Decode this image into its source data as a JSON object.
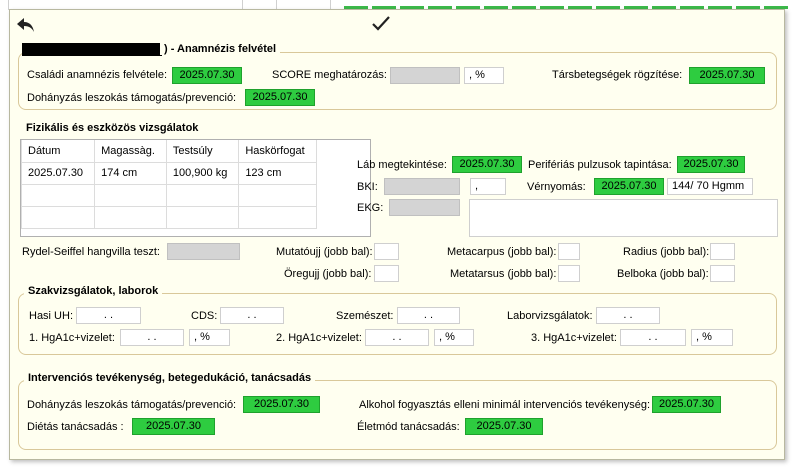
{
  "toolbar": {
    "back_icon": "back-arrow-icon",
    "confirm_icon": "checkmark-icon"
  },
  "anamnesis": {
    "title": ") - Anamnézis felvétel",
    "family_label": "Családi anamnézis felvétele:",
    "family_date": "2025.07.30",
    "score_label": "SCORE meghatározás:",
    "score_unit": ", %",
    "comorb_label": "Társbetegségek rögzítése:",
    "comorb_date": "2025.07.30",
    "smoking_label": "Dohányzás leszokás támogatás/prevenció:",
    "smoking_date": "2025.07.30"
  },
  "exam": {
    "title": "Fizikális és eszközös vizsgálatok",
    "columns": [
      "Dátum",
      "Magassàg.",
      "Testsúly",
      "Haskörfogat"
    ],
    "rows": [
      [
        "2025.07.30",
        "174 cm",
        "100,900 kg",
        "123 cm"
      ]
    ],
    "foot_label": "Láb megtekintése:",
    "foot_date": "2025.07.30",
    "pulse_label": "Perifériás pulzusok tapintása:",
    "pulse_date": "2025.07.30",
    "bmi_label": "BKI:",
    "bmi_value": ",",
    "bp_label": "Vérnyomás:",
    "bp_date": "2025.07.30",
    "bp_value": "144/ 70 Hgmm",
    "ekg_label": "EKG:",
    "rydel_label": "Rydel-Seiffel hangvilla teszt:",
    "pointer_label": "Mutatóujj (jobb bal):",
    "metacarpus_label": "Metacarpus (jobb bal):",
    "radius_label": "Radius (jobb bal):",
    "bigtoe_label": "Öregujj (jobb bal):",
    "metatarsus_label": "Metatarsus (jobb bal):",
    "ankle_label": "Belboka (jobb bal):"
  },
  "specialist": {
    "title": "Szakvizsgálatok, laborok",
    "hasi_label": "Hasi UH:",
    "hasi_value": ". .",
    "cds_label": "CDS:",
    "cds_value": ". .",
    "eye_label": "Szemészet:",
    "eye_value": ". .",
    "lab_label": "Laborvizsgálatok:",
    "lab_value": ". .",
    "hba1c1_label": "1. HgA1c+vizelet:",
    "hba1c1_date": ". .",
    "hba1c1_pct": ", %",
    "hba1c2_label": "2. HgA1c+vizelet:",
    "hba1c2_date": ". .",
    "hba1c2_pct": ", %",
    "hba1c3_label": "3. HgA1c+vizelet:",
    "hba1c3_date": ". .",
    "hba1c3_pct": ", %"
  },
  "intervention": {
    "title": "Intervenciós tevékenység, betegedukáció, tanácsadás",
    "smoking_label": "Dohányzás leszokás támogatás/prevenció:",
    "smoking_date": "2025.07.30",
    "alcohol_label": "Alkohol fogyasztás elleni minimál intervenciós tevékenység:",
    "alcohol_date": "2025.07.30",
    "diet_label": "Diétás tanácsadás :",
    "diet_date": "2025.07.30",
    "lifestyle_label": "Életmód tanácsadás:",
    "lifestyle_date": "2025.07.30"
  }
}
